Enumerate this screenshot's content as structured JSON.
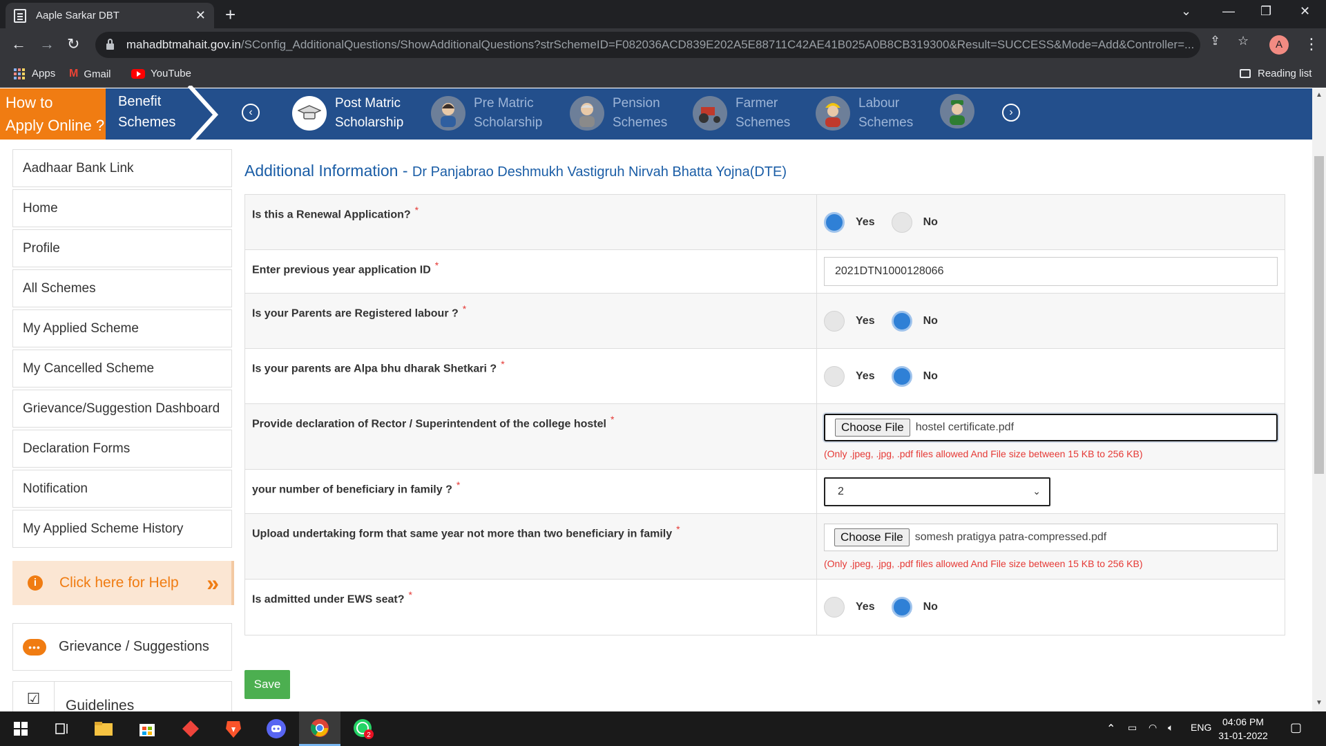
{
  "browser": {
    "tab_title": "Aaple Sarkar DBT",
    "url_host": "mahadbtmahait.gov.in",
    "url_path": "/SConfig_AdditionalQuestions/ShowAdditionalQuestions?strSchemeID=F082036ACD839E202A5E88711C42AE41B025A0B8CB319300&Result=SUCCESS&Mode=Add&Controller=...",
    "profile_initial": "A",
    "bookmarks": [
      "Apps",
      "Gmail",
      "YouTube"
    ],
    "reading_list": "Reading list"
  },
  "header": {
    "howto_line1": "How to",
    "howto_line2": "Apply Online ?",
    "benefit_line1": "Benefit",
    "benefit_line2": "Schemes",
    "schemes": [
      {
        "line1": "Post Matric",
        "line2": "Scholarship",
        "icon": "graduation-cap-icon"
      },
      {
        "line1": "Pre Matric",
        "line2": "Scholarship",
        "icon": "student-icon"
      },
      {
        "line1": "Pension",
        "line2": "Schemes",
        "icon": "elderly-icon"
      },
      {
        "line1": "Farmer",
        "line2": "Schemes",
        "icon": "tractor-icon"
      },
      {
        "line1": "Labour",
        "line2": "Schemes",
        "icon": "worker-icon"
      }
    ]
  },
  "sidebar": {
    "items": [
      "Aadhaar Bank Link",
      "Home",
      "Profile",
      "All Schemes",
      "My Applied Scheme",
      "My Cancelled Scheme",
      "Grievance/Suggestion Dashboard",
      "Declaration Forms",
      "Notification",
      "My Applied Scheme History"
    ],
    "help_text": "Click here for Help",
    "grievance_text": "Grievance / Suggestions",
    "guidelines_text": "Guidelines"
  },
  "form": {
    "title_main": "Additional Information - ",
    "title_scheme": "Dr Panjabrao Deshmukh Vastigruh Nirvah Bhatta Yojna(DTE)",
    "yes_label": "Yes",
    "no_label": "No",
    "required_mark": "*",
    "file_hint": "(Only .jpeg, .jpg, .pdf files allowed And File size between 15 KB to 256 KB)",
    "choose_file": "Choose File",
    "q1": {
      "label": "Is this a Renewal Application?",
      "selected": "Yes"
    },
    "q2": {
      "label": "Enter previous year application ID",
      "value": "2021DTN1000128066"
    },
    "q3": {
      "label": "Is your Parents are Registered labour ?",
      "selected": "No"
    },
    "q4": {
      "label": "Is your parents are Alpa bhu dharak Shetkari ?",
      "selected": "No"
    },
    "q5": {
      "label": "Provide declaration of Rector / Superintendent of the college hostel",
      "file": "hostel certificate.pdf"
    },
    "q6": {
      "label": "your number of beneficiary in family ?",
      "value": "2"
    },
    "q7": {
      "label": "Upload undertaking form that same year not more than two beneficiary in family",
      "file": "somesh pratigya patra-compressed.pdf"
    },
    "q8": {
      "label": "Is admitted under EWS seat?",
      "selected": "No"
    },
    "save_label": "Save"
  },
  "taskbar": {
    "language": "ENG",
    "time": "04:06 PM",
    "date": "31-01-2022",
    "whatsapp_badge": "2"
  }
}
